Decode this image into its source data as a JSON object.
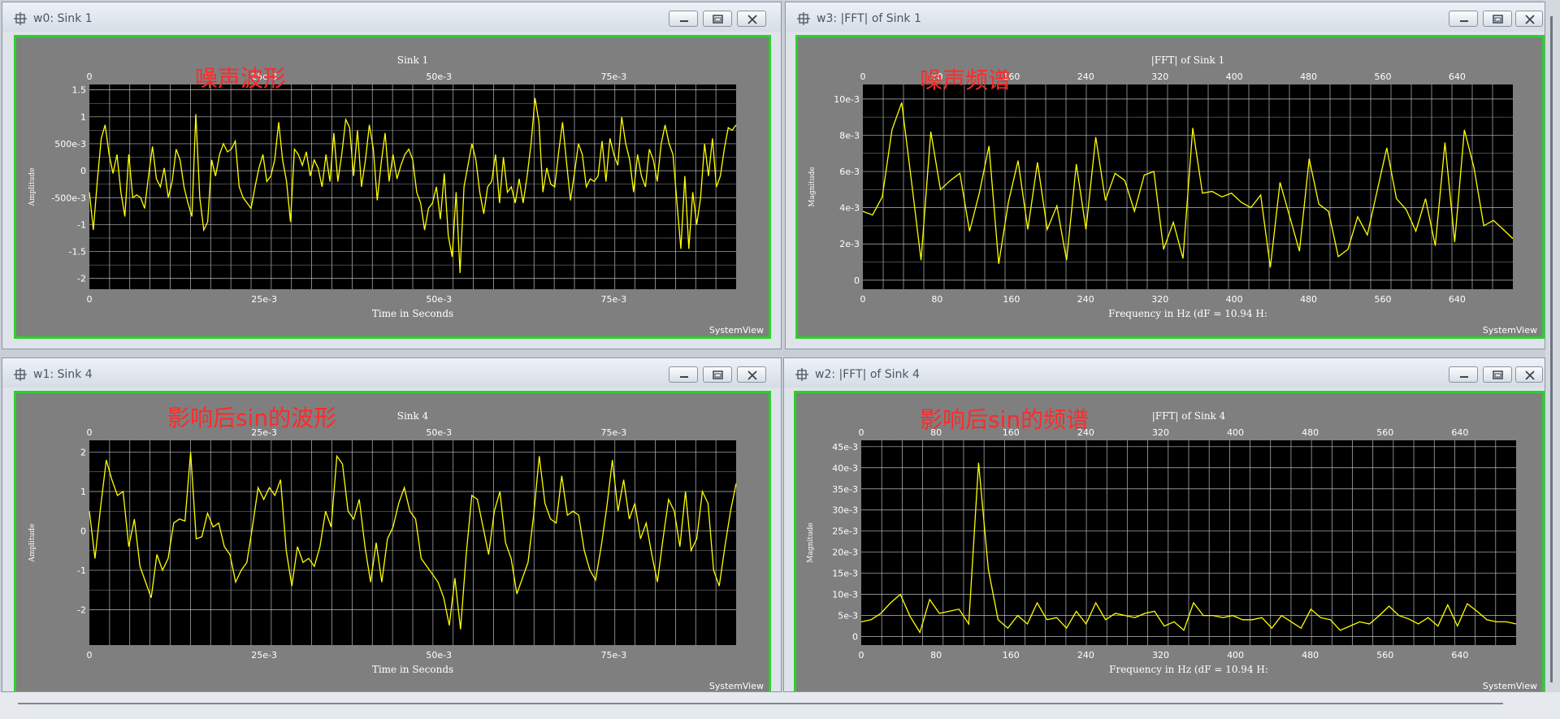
{
  "windows": [
    {
      "id": "w0",
      "title": "w0: Sink 1",
      "annotation": "噪声波形",
      "brand": "SystemView",
      "chart_data": {
        "type": "line",
        "title": "Sink 1",
        "xlabel": "Time in Seconds",
        "ylabel": "Amplitude",
        "xlim": [
          0,
          0.0925
        ],
        "ylim": [
          -2.2,
          1.6
        ],
        "xticks": [
          0,
          0.025,
          0.05,
          0.075
        ],
        "xtick_labels": [
          "0",
          "25e-3",
          "50e-3",
          "75e-3"
        ],
        "yticks": [
          1.5,
          1,
          0.5,
          0,
          -0.5,
          -1,
          -1.5,
          -2
        ],
        "ytick_labels": [
          "1.5",
          "1",
          "500e-3",
          "0",
          "-500e-3",
          "-1",
          "-1.5",
          "-2"
        ],
        "grid": true,
        "color": "#ffff00",
        "values": [
          -0.4,
          -1.1,
          -0.2,
          0.6,
          0.85,
          0.3,
          -0.05,
          0.3,
          -0.4,
          -0.85,
          0.3,
          -0.5,
          -0.45,
          -0.5,
          -0.7,
          -0.1,
          0.45,
          -0.15,
          -0.3,
          0.05,
          -0.5,
          -0.2,
          0.4,
          0.2,
          -0.3,
          -0.6,
          -0.85,
          1.05,
          -0.5,
          -1.1,
          -0.95,
          0.2,
          -0.1,
          0.3,
          0.5,
          0.35,
          0.4,
          0.55,
          -0.3,
          -0.5,
          -0.6,
          -0.7,
          -0.3,
          0.05,
          0.3,
          -0.2,
          -0.1,
          0.2,
          0.9,
          0.2,
          -0.2,
          -0.95,
          0.4,
          0.3,
          0.1,
          0.35,
          -0.1,
          0.2,
          0.05,
          -0.3,
          0.3,
          -0.2,
          0.7,
          -0.2,
          0.3,
          0.95,
          0.8,
          -0.1,
          0.75,
          -0.3,
          0.2,
          0.85,
          0.4,
          -0.55,
          0.15,
          0.7,
          -0.2,
          0.3,
          -0.15,
          0.1,
          0.3,
          0.4,
          0.2,
          -0.4,
          -0.6,
          -1.1,
          -0.7,
          -0.6,
          -0.3,
          -0.9,
          -0.05,
          -1.2,
          -1.6,
          -0.4,
          -1.9,
          -0.3,
          0.1,
          0.5,
          0.2,
          -0.4,
          -0.8,
          -0.3,
          -0.2,
          0.3,
          -0.6,
          0.25,
          -0.4,
          -0.3,
          -0.6,
          -0.15,
          -0.6,
          -0.1,
          0.5,
          1.35,
          0.9,
          -0.4,
          0.05,
          -0.25,
          -0.3,
          0.35,
          0.9,
          0.15,
          -0.55,
          -0.05,
          0.5,
          0.3,
          -0.3,
          -0.15,
          -0.2,
          -0.1,
          0.55,
          -0.2,
          0.6,
          0.3,
          0.1,
          1.0,
          0.5,
          0.2,
          -0.4,
          0.3,
          -0.1,
          -0.3,
          0.4,
          0.2,
          -0.2,
          0.5,
          0.85,
          0.5,
          0.3,
          -0.6,
          -1.45,
          -0.1,
          -1.45,
          -0.4,
          -1.0,
          -0.5,
          0.5,
          -0.1,
          0.6,
          -0.3,
          -0.1,
          0.4,
          0.8,
          0.75,
          0.85
        ]
      }
    },
    {
      "id": "w3",
      "title": "w3: |FFT| of Sink 1",
      "annotation": "噪声频谱",
      "brand": "SystemView",
      "chart_data": {
        "type": "line",
        "title": "|FFT| of Sink 1",
        "xlabel": "Frequency in Hz (dF = 10.94 H:",
        "ylabel": "Magnitude",
        "xlim": [
          0,
          700
        ],
        "ylim": [
          -0.0005,
          0.0108
        ],
        "xticks": [
          0,
          80,
          160,
          240,
          320,
          400,
          480,
          560,
          640
        ],
        "xtick_labels": [
          "0",
          "80",
          "160",
          "240",
          "320",
          "400",
          "480",
          "560",
          "640"
        ],
        "yticks": [
          0.01,
          0.008,
          0.006,
          0.004,
          0.002,
          0
        ],
        "ytick_labels": [
          "10e-3",
          "8e-3",
          "6e-3",
          "4e-3",
          "2e-3",
          "0"
        ],
        "grid": true,
        "color": "#ffff00",
        "values": [
          0.0038,
          0.0036,
          0.0046,
          0.0083,
          0.0098,
          0.0055,
          0.0011,
          0.0082,
          0.005,
          0.0055,
          0.0059,
          0.0027,
          0.0048,
          0.0074,
          0.0009,
          0.0043,
          0.0066,
          0.0028,
          0.0065,
          0.0028,
          0.0041,
          0.0011,
          0.0064,
          0.0028,
          0.0079,
          0.0044,
          0.0059,
          0.0055,
          0.0038,
          0.0058,
          0.006,
          0.0017,
          0.0032,
          0.0012,
          0.0084,
          0.0048,
          0.0049,
          0.0046,
          0.0048,
          0.0043,
          0.004,
          0.0047,
          0.0007,
          0.0054,
          0.0035,
          0.0016,
          0.0067,
          0.0042,
          0.0038,
          0.0013,
          0.0017,
          0.0035,
          0.0025,
          0.0049,
          0.0073,
          0.0045,
          0.0039,
          0.0027,
          0.0045,
          0.0019,
          0.0076,
          0.0021,
          0.0083,
          0.0062,
          0.003,
          0.0033,
          0.0028,
          0.0023
        ]
      }
    },
    {
      "id": "w1",
      "title": "w1: Sink 4",
      "annotation": "影响后sin的波形",
      "brand": "SystemView",
      "chart_data": {
        "type": "line",
        "title": "Sink 4",
        "xlabel": "Time in Seconds",
        "ylabel": "Amplitude",
        "xlim": [
          0,
          0.0925
        ],
        "ylim": [
          -2.9,
          2.3
        ],
        "xticks": [
          0,
          0.025,
          0.05,
          0.075
        ],
        "xtick_labels": [
          "0",
          "25e-3",
          "50e-3",
          "75e-3"
        ],
        "yticks": [
          2,
          1,
          0,
          -1,
          -2
        ],
        "ytick_labels": [
          "2",
          "1",
          "0",
          "-1",
          "-2"
        ],
        "grid": true,
        "color": "#ffff00",
        "values": [
          0.5,
          -0.7,
          0.6,
          1.8,
          1.3,
          0.9,
          1.0,
          -0.4,
          0.3,
          -0.9,
          -1.3,
          -1.7,
          -0.6,
          -1.0,
          -0.7,
          0.2,
          0.3,
          0.25,
          2.0,
          -0.2,
          -0.15,
          0.45,
          0.1,
          0.2,
          -0.4,
          -0.6,
          -1.3,
          -1.0,
          -0.8,
          0.1,
          1.1,
          0.8,
          1.1,
          0.9,
          1.3,
          -0.5,
          -1.4,
          -0.4,
          -0.8,
          -0.7,
          -0.9,
          -0.4,
          0.5,
          0.1,
          1.9,
          1.7,
          0.5,
          0.3,
          0.8,
          -0.4,
          -1.3,
          -0.3,
          -1.3,
          -0.2,
          0.1,
          0.7,
          1.1,
          0.5,
          0.3,
          -0.7,
          -0.9,
          -1.1,
          -1.3,
          -1.7,
          -2.4,
          -1.2,
          -2.5,
          -0.6,
          0.9,
          0.8,
          0.1,
          -0.6,
          0.5,
          1.0,
          -0.3,
          -0.7,
          -1.6,
          -1.2,
          -0.8,
          0.4,
          1.9,
          0.7,
          0.3,
          0.2,
          1.4,
          0.4,
          0.5,
          0.4,
          -0.5,
          -1.0,
          -1.25,
          -0.4,
          0.6,
          1.8,
          0.5,
          1.3,
          0.3,
          0.7,
          -0.2,
          0.2,
          -0.6,
          -1.3,
          -0.2,
          0.8,
          0.5,
          -0.4,
          1.0,
          -0.5,
          -0.2,
          1.0,
          0.7,
          -1.0,
          -1.4,
          -0.4,
          0.5,
          1.2
        ]
      }
    },
    {
      "id": "w2",
      "title": "w2: |FFT| of Sink 4",
      "annotation": "影响后sin的频谱",
      "brand": "SystemView",
      "chart_data": {
        "type": "line",
        "title": "|FFT| of Sink 4",
        "xlabel": "Frequency in Hz (dF = 10.94 H:",
        "ylabel": "Magnitude",
        "xlim": [
          0,
          700
        ],
        "ylim": [
          -0.002,
          0.0465
        ],
        "xticks": [
          0,
          80,
          160,
          240,
          320,
          400,
          480,
          560,
          640
        ],
        "xtick_labels": [
          "0",
          "80",
          "160",
          "240",
          "320",
          "400",
          "480",
          "560",
          "640"
        ],
        "yticks": [
          0.045,
          0.04,
          0.035,
          0.03,
          0.025,
          0.02,
          0.015,
          0.01,
          0.005,
          0
        ],
        "ytick_labels": [
          "45e-3",
          "40e-3",
          "35e-3",
          "30e-3",
          "25e-3",
          "20e-3",
          "15e-3",
          "10e-3",
          "5e-3",
          "0"
        ],
        "grid": true,
        "color": "#ffff00",
        "values": [
          0.0035,
          0.004,
          0.0055,
          0.008,
          0.01,
          0.0048,
          0.001,
          0.0088,
          0.0055,
          0.006,
          0.0065,
          0.003,
          0.0412,
          0.016,
          0.004,
          0.002,
          0.005,
          0.003,
          0.008,
          0.004,
          0.0045,
          0.002,
          0.006,
          0.003,
          0.008,
          0.004,
          0.0055,
          0.005,
          0.0045,
          0.0055,
          0.006,
          0.0025,
          0.0035,
          0.0015,
          0.008,
          0.005,
          0.005,
          0.0045,
          0.005,
          0.004,
          0.004,
          0.0045,
          0.002,
          0.005,
          0.0035,
          0.002,
          0.0065,
          0.0045,
          0.004,
          0.0015,
          0.0025,
          0.0035,
          0.003,
          0.005,
          0.0072,
          0.005,
          0.0042,
          0.003,
          0.0045,
          0.0025,
          0.0075,
          0.0025,
          0.0078,
          0.006,
          0.004,
          0.0035,
          0.0035,
          0.003
        ]
      }
    }
  ]
}
